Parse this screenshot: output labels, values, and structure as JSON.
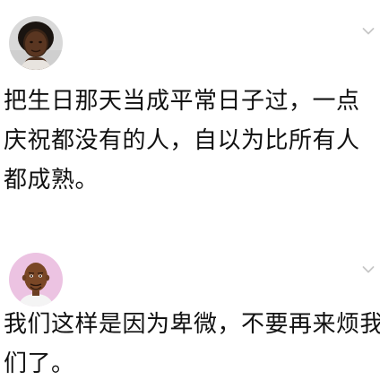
{
  "posts": [
    {
      "avatar_icon": "user-avatar-woman",
      "menu_icon": "chevron-down-icon",
      "text_lines": [
        "把生日那天当成平常日子过，一点",
        "庆祝都没有的人，自以为比所有人",
        "都成熟。"
      ]
    },
    {
      "avatar_icon": "user-avatar-bitmoji",
      "menu_icon": "chevron-down-icon",
      "text_lines": [
        "我们这样是因为卑微，不要再来烦我",
        "们了。"
      ]
    }
  ],
  "colors": {
    "background": "#ffffff",
    "text": "#111111",
    "chevron": "#c7c7c7",
    "avatar2_background": "#ecc3e2"
  }
}
